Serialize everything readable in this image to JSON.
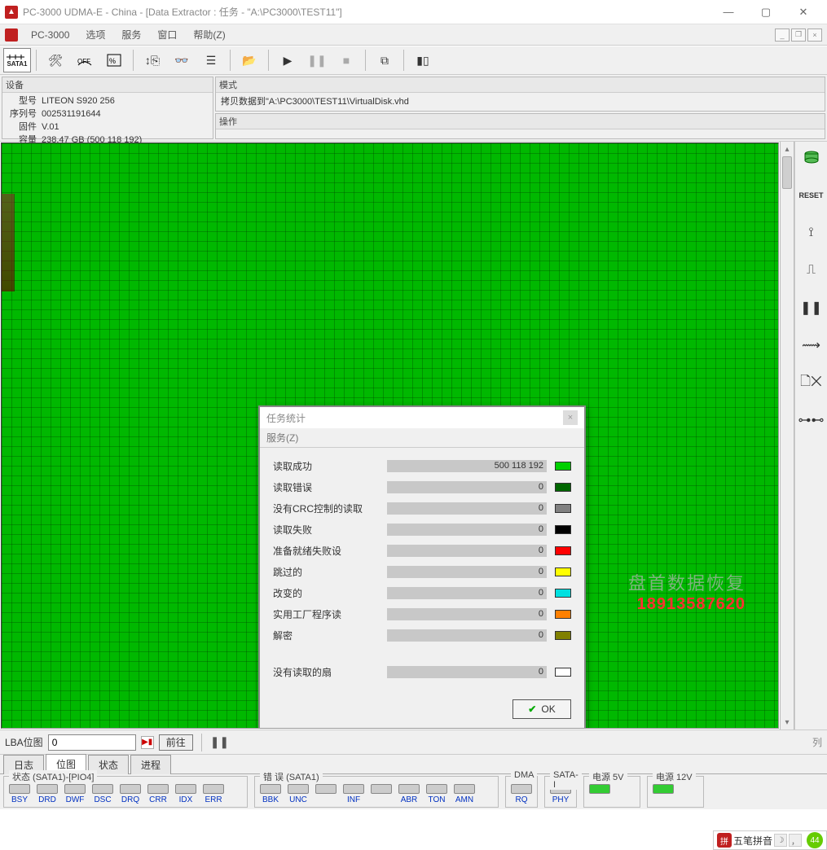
{
  "window": {
    "title": "PC-3000 UDMA-E - China - [Data Extractor : 任务 - \"A:\\PC3000\\TEST11\"]",
    "app_name": "PC-3000"
  },
  "mdi_menu": [
    "选项",
    "服务",
    "窗口",
    "帮助(Z)"
  ],
  "toolbar": {
    "sata_label": "SATA1"
  },
  "device_panel": {
    "header": "设备",
    "rows": [
      {
        "k": "型号",
        "v": "LITEON S920 256"
      },
      {
        "k": "序列号",
        "v": "002531191644"
      },
      {
        "k": "固件",
        "v": "V.01"
      },
      {
        "k": "容量",
        "v": "238.47 GB (500 118 192)"
      }
    ]
  },
  "mode_panel": {
    "header": "模式",
    "value": "拷贝数据到\"A:\\PC3000\\TEST11\\VirtualDisk.vhd"
  },
  "operation_panel": {
    "header": "操作",
    "value": ""
  },
  "dialog": {
    "title": "任务统计",
    "menu": "服务(Z)",
    "ok_label": "OK",
    "stats": [
      {
        "label": "读取成功",
        "value": "500 118 192",
        "color": "#00d000"
      },
      {
        "label": "读取错误",
        "value": "0",
        "color": "#006600"
      },
      {
        "label": "没有CRC控制的读取",
        "value": "0",
        "color": "#808080"
      },
      {
        "label": "读取失败",
        "value": "0",
        "color": "#000000"
      },
      {
        "label": "准备就绪失败设",
        "value": "0",
        "color": "#ff0000"
      },
      {
        "label": "跳过的",
        "value": "0",
        "color": "#ffff00"
      },
      {
        "label": "改变的",
        "value": "0",
        "color": "#00e0e0"
      },
      {
        "label": "实用工厂程序读",
        "value": "0",
        "color": "#ff8000"
      },
      {
        "label": "解密",
        "value": "0",
        "color": "#808000"
      }
    ],
    "unread": {
      "label": "没有读取的扇",
      "value": "0",
      "color": "#ffffff"
    }
  },
  "watermark": {
    "text": "盘首数据恢复",
    "phone": "18913587620"
  },
  "lba": {
    "label": "LBA位图",
    "value": "0",
    "goto_label": "前往",
    "tail_label": "列"
  },
  "tabs": [
    "日志",
    "位图",
    "状态",
    "进程"
  ],
  "tabs_active_index": 1,
  "status": {
    "state_title": "状态 (SATA1)-[PIO4]",
    "errors_title": "错 误 (SATA1)",
    "dma_title": "DMA",
    "satai_title": "SATA-I",
    "power5_title": "电源 5V",
    "power12_title": "电源 12V",
    "state_leds": [
      "BSY",
      "DRD",
      "DWF",
      "DSC",
      "DRQ",
      "CRR",
      "IDX",
      "ERR"
    ],
    "error_leds": [
      "BBK",
      "UNC",
      "",
      "INF",
      "",
      "ABR",
      "TON",
      "AMN"
    ],
    "dma_leds": [
      "RQ"
    ],
    "satai_leds": [
      "PHY"
    ]
  },
  "ime": {
    "text": "五笔拼音",
    "badge": "44"
  }
}
